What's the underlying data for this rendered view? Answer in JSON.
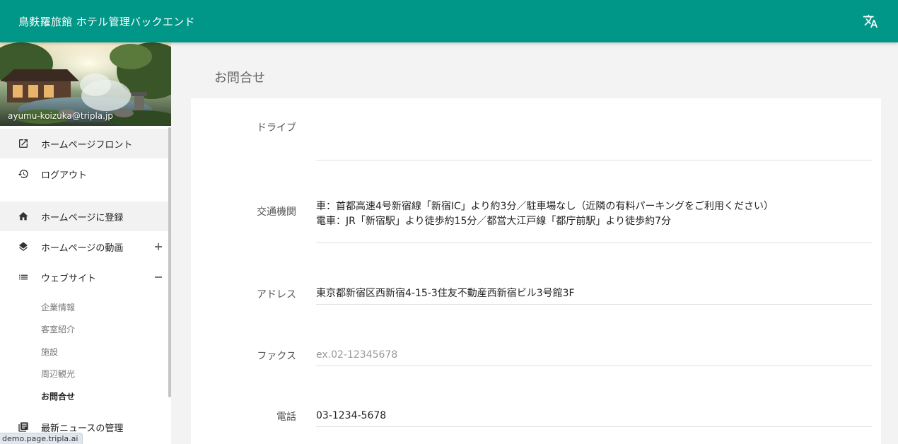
{
  "app": {
    "title": "鳥麩羅旅館 ホテル管理バックエンド",
    "accent": "#009688"
  },
  "sidebar": {
    "email": "ayumu-koizuka@tripla.jp",
    "items": [
      {
        "label": "ホームページフロント",
        "icon": "external-link-icon"
      },
      {
        "label": "ログアウト",
        "icon": "history-icon"
      },
      {
        "label": "ホームページに登録",
        "icon": "home-icon"
      },
      {
        "label": "ホームページの動画",
        "icon": "layers-icon",
        "toggle": "+"
      },
      {
        "label": "ウェブサイト",
        "icon": "list-icon",
        "toggle": "−"
      },
      {
        "label": "最新ニュースの管理",
        "icon": "news-icon"
      }
    ],
    "website_subitems": [
      "企業情報",
      "客室紹介",
      "施設",
      "周辺観光",
      "お問合せ"
    ]
  },
  "page": {
    "title": "お問合せ",
    "fields": [
      {
        "label": "ドライブ",
        "lines": [
          ""
        ]
      },
      {
        "label": "交通機関",
        "lines": [
          "車：首都高速4号新宿線「新宿IC」より約3分／駐車場なし（近隣の有料パーキングをご利用ください）",
          "電車：JR「新宿駅」より徒歩約15分／都営大江戸線「都庁前駅」より徒歩約7分"
        ]
      },
      {
        "label": "アドレス",
        "value": "東京都新宿区西新宿4-15-3住友不動産西新宿ビル3号館3F"
      },
      {
        "label": "ファクス",
        "placeholder": "ex.02-12345678"
      },
      {
        "label": "電話",
        "value": "03-1234-5678"
      }
    ]
  },
  "status_bar": {
    "url": "demo.page.tripla.ai"
  }
}
